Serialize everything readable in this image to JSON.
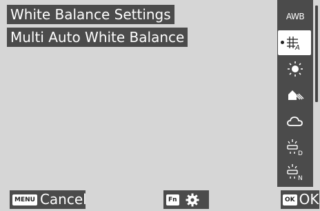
{
  "header": {
    "title": "White Balance Settings",
    "subtitle": "Multi Auto White Balance"
  },
  "wb_modes": [
    {
      "id": "awb",
      "label": "AWB",
      "icon": "awb-text-icon"
    },
    {
      "id": "multi-auto",
      "label": "",
      "icon": "multi-auto-wb-icon",
      "selected": true
    },
    {
      "id": "daylight",
      "label": "",
      "icon": "sun-icon"
    },
    {
      "id": "shade",
      "label": "",
      "icon": "shade-house-icon"
    },
    {
      "id": "cloudy",
      "label": "",
      "icon": "cloud-icon"
    },
    {
      "id": "fluorescent-d",
      "label": "",
      "icon": "fluorescent-d-icon"
    },
    {
      "id": "fluorescent-n",
      "label": "",
      "icon": "fluorescent-n-icon"
    }
  ],
  "footer": {
    "menu_key": "MENU",
    "cancel_label": "Cancel",
    "fn_key": "Fn",
    "ok_key": "OK",
    "ok_label": "OK"
  },
  "colors": {
    "screen_bg": "#d6d6d6",
    "panel_bg": "#4b4b4b",
    "text": "#ffffff",
    "selected_bg": "#ffffff"
  }
}
